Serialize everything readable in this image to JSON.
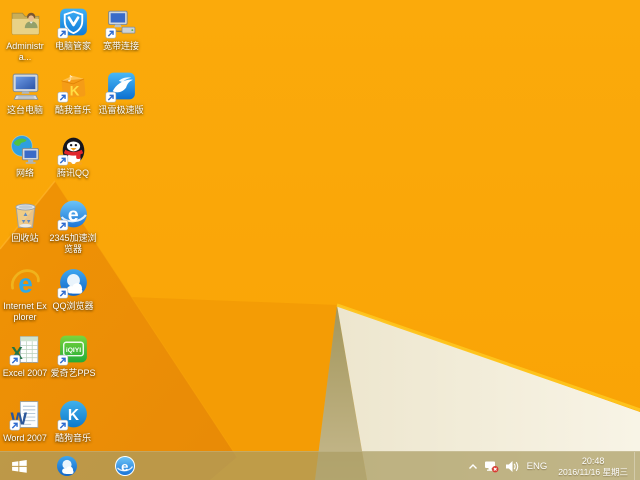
{
  "wallpaper": {
    "base_color": "#FAA607",
    "dark_facet_color": "#ED8F04",
    "mid_facet_color": "#F49C05",
    "olive_facet_color": "#B0A269",
    "cream_facet_color": "#F2ECD8",
    "ridge_color": "#FFC51E"
  },
  "desktop": {
    "icons": [
      {
        "icon": "administrator-folder-icon",
        "label": "Administra..."
      },
      {
        "icon": "pc-manager-icon",
        "label": "电脑管家"
      },
      {
        "icon": "broadband-connection-icon",
        "label": "宽带连接"
      },
      {
        "icon": "this-pc-icon",
        "label": "这台电脑"
      },
      {
        "icon": "kuwo-music-icon",
        "label": "酷我音乐"
      },
      {
        "icon": "xunlei-icon",
        "label": "迅雷极速版"
      },
      {
        "icon": "network-icon",
        "label": "网络"
      },
      {
        "icon": "qq-icon",
        "label": "腾讯QQ"
      },
      {
        "icon": "recycle-bin-icon",
        "label": "回收站"
      },
      {
        "icon": "2345-browser-icon",
        "label": "2345加速浏览器"
      },
      {
        "icon": "internet-explorer-icon",
        "label": "Internet Explorer"
      },
      {
        "icon": "qq-browser-icon",
        "label": "QQ浏览器"
      },
      {
        "icon": "excel-2007-icon",
        "label": "Excel 2007"
      },
      {
        "icon": "iqiyi-pps-icon",
        "label": "爱奇艺PPS"
      },
      {
        "icon": "word-2007-icon",
        "label": "Word 2007"
      },
      {
        "icon": "kugou-music-icon",
        "label": "酷狗音乐"
      }
    ]
  },
  "taskbar": {
    "start": {
      "icon": "windows-start-icon"
    },
    "apps": [
      {
        "icon": "qq-browser-taskbar-icon"
      },
      {
        "icon": "e-browser-taskbar-icon"
      }
    ],
    "tray": {
      "hidden_icons": {
        "icon": "chevron-up-icon"
      },
      "network": {
        "icon": "network-disconnected-icon"
      },
      "volume": {
        "icon": "volume-icon"
      },
      "language": "ENG",
      "time": "20:48",
      "date": "2016/11/16 星期三"
    }
  }
}
